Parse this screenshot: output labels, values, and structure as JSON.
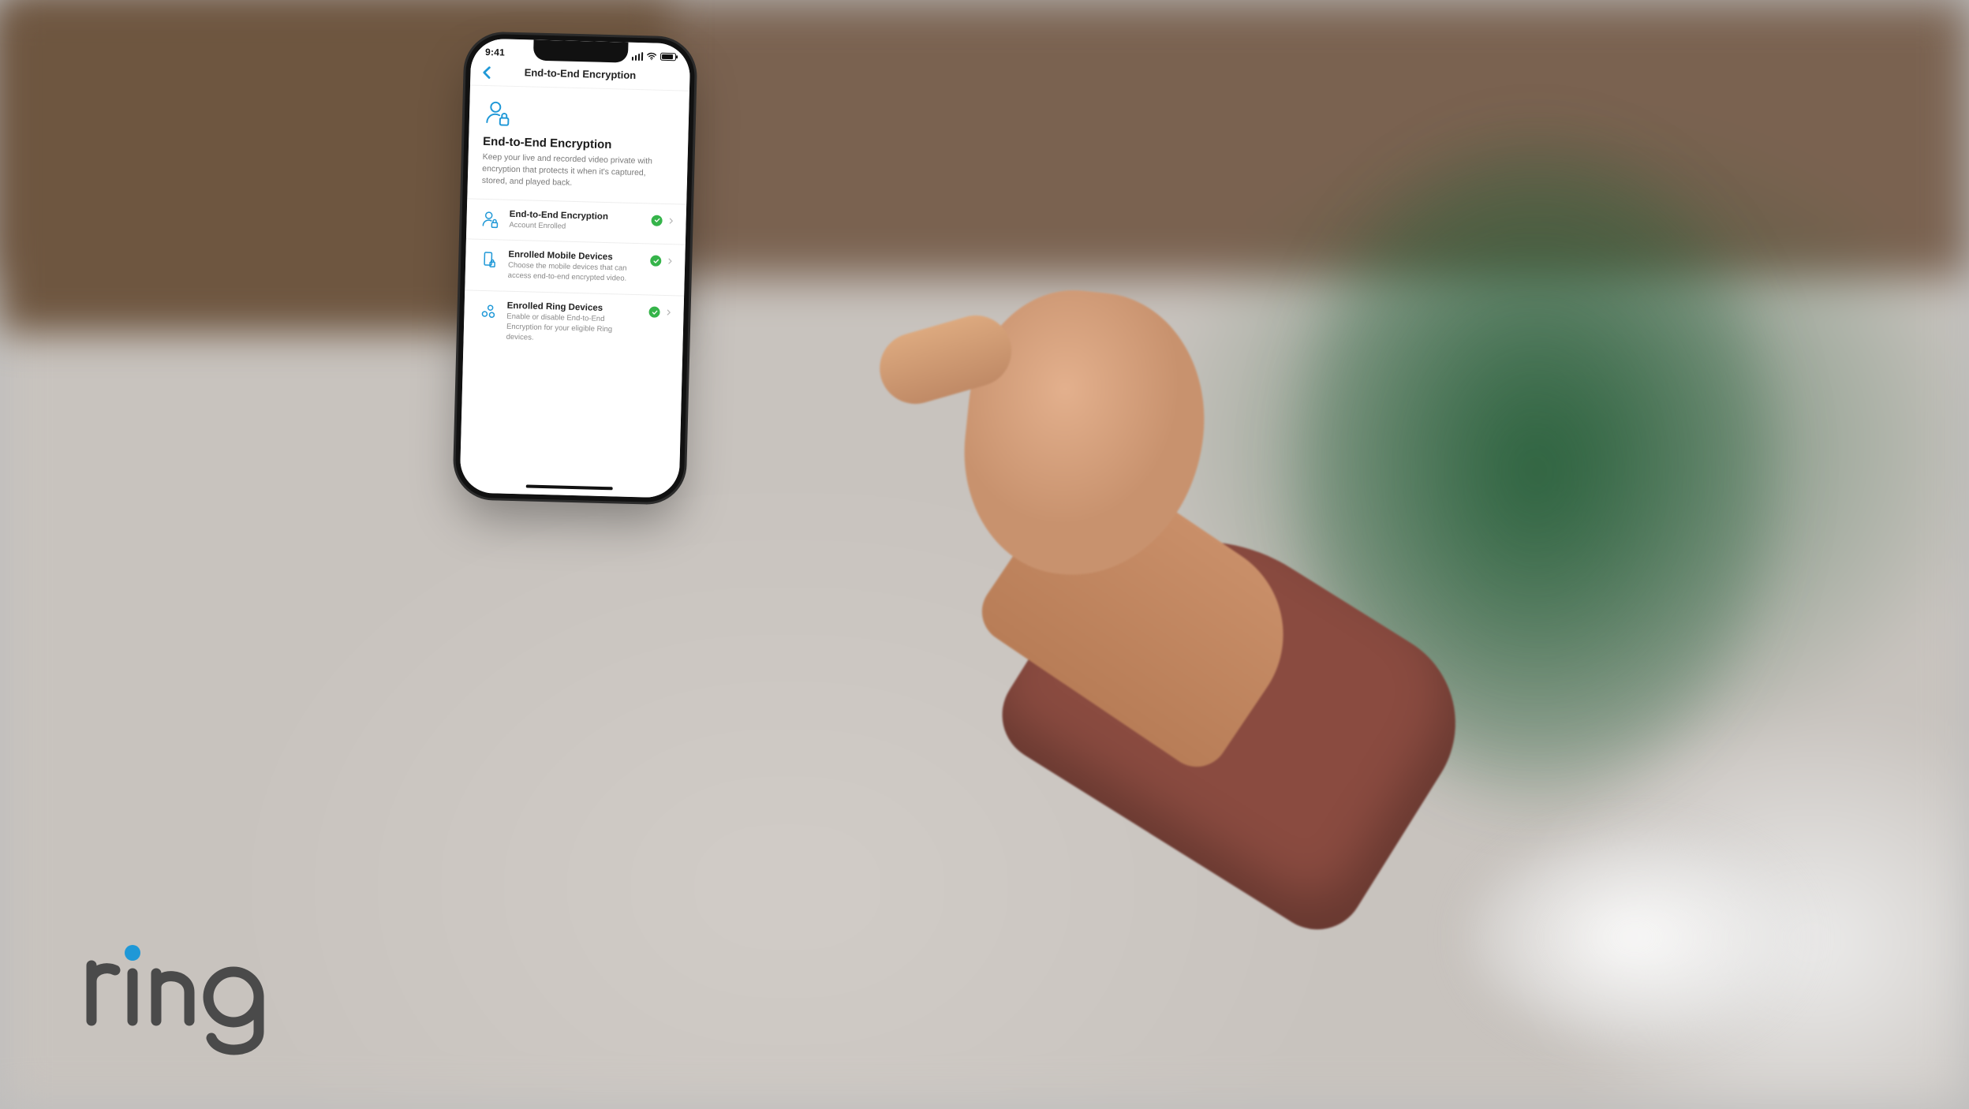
{
  "brand": {
    "name": "ring"
  },
  "status_bar": {
    "time": "9:41"
  },
  "nav": {
    "title": "End-to-End Encryption"
  },
  "hero": {
    "title": "End-to-End Encryption",
    "body": "Keep your live and recorded video private with encryption that protects it when it's captured, stored, and played back."
  },
  "rows": [
    {
      "title": "End-to-End Encryption",
      "subtitle": "Account Enrolled",
      "status": "ok"
    },
    {
      "title": "Enrolled Mobile Devices",
      "subtitle": "Choose the mobile devices that can access end-to-end encrypted video.",
      "status": "ok"
    },
    {
      "title": "Enrolled Ring Devices",
      "subtitle": "Enable or disable End-to-End Encryption for your eligible Ring devices.",
      "status": "ok"
    }
  ],
  "colors": {
    "accent": "#1f98d7",
    "ok": "#35b44a"
  }
}
